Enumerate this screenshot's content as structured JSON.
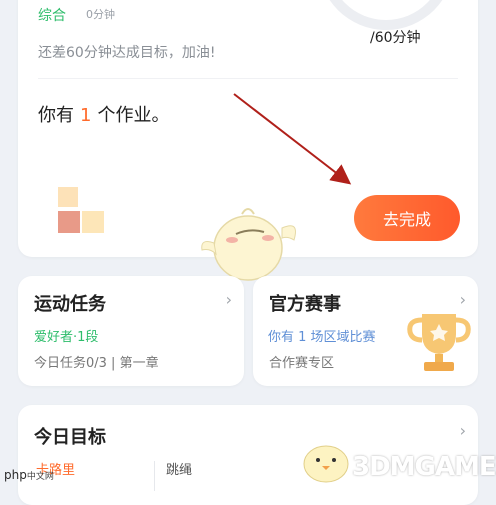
{
  "goal_summary": {
    "category": "综合",
    "category_minutes": "0分钟",
    "ring_target": "/60分钟",
    "encouragement": "还差60分钟达成目标，加油!"
  },
  "homework": {
    "prefix": "你有",
    "count": "1",
    "suffix": "个作业。",
    "button_label": "去完成"
  },
  "sport_tasks": {
    "title": "运动任务",
    "level": "爱好者·1段",
    "progress": "今日任务0/3 | 第一章"
  },
  "competitions": {
    "title": "官方赛事",
    "info": "你有 1 场区域比赛",
    "zone": "合作赛专区"
  },
  "daily_goal": {
    "title": "今日目标",
    "calories_label": "卡路里",
    "rope_label": "跳绳"
  },
  "watermarks": {
    "php_main": "php",
    "php_sub": "中文网",
    "game_site": "3DMGAME"
  },
  "colors": {
    "accent_orange": "#ff5a2c",
    "green": "#2ebd6b",
    "blue": "#5f8fd6"
  }
}
